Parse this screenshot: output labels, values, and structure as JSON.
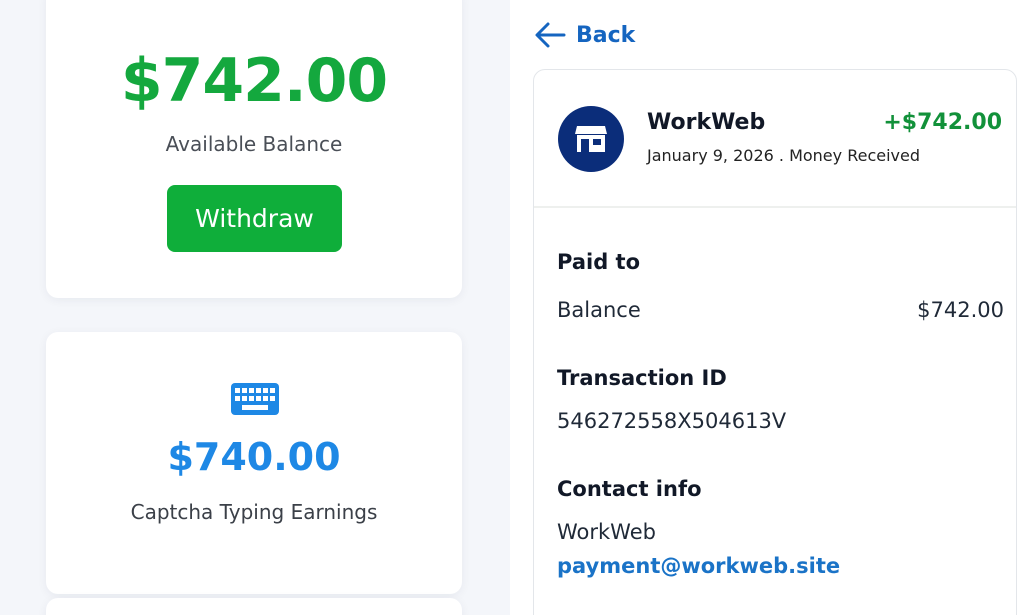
{
  "balance_card": {
    "amount": "$742.00",
    "label": "Available Balance",
    "withdraw_label": "Withdraw"
  },
  "captcha_card": {
    "icon": "keyboard-icon",
    "amount": "$740.00",
    "label": "Captcha Typing Earnings"
  },
  "nav": {
    "back_label": "Back",
    "back_icon": "arrow-left-icon"
  },
  "transaction": {
    "merchant_icon": "store-icon",
    "merchant": "WorkWeb",
    "amount": "+$742.00",
    "subtitle": "January 9, 2026 . Money Received",
    "paid_to_heading": "Paid to",
    "paid_to_account": "Balance",
    "paid_to_amount": "$742.00",
    "transaction_id_heading": "Transaction ID",
    "transaction_id": "546272558X504613V",
    "contact_heading": "Contact info",
    "contact_name": "WorkWeb",
    "contact_email": "payment@workweb.site"
  },
  "colors": {
    "balance_green": "#14a83e",
    "withdraw_button": "#0fae3a",
    "captcha_blue": "#1e88e5",
    "link_blue": "#1565c0",
    "avatar_navy": "#0b2d7a",
    "amount_green": "#12913a"
  }
}
